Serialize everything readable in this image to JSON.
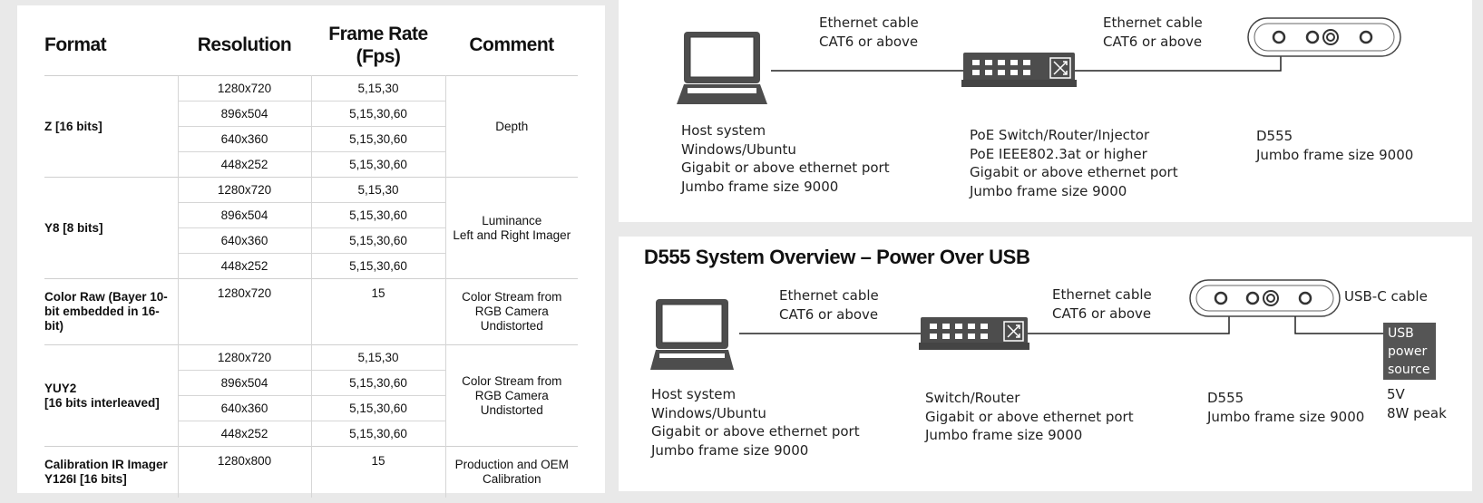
{
  "table": {
    "headers": {
      "format": "Format",
      "resolution": "Resolution",
      "frame_rate_1": "Frame Rate",
      "frame_rate_2": "(Fps)",
      "comment": "Comment"
    },
    "groups": [
      {
        "format": "Z [16 bits]",
        "comment": [
          "Depth"
        ],
        "rows": [
          {
            "res": "1280x720",
            "fps": "5,15,30"
          },
          {
            "res": "896x504",
            "fps": "5,15,30,60"
          },
          {
            "res": "640x360",
            "fps": "5,15,30,60"
          },
          {
            "res": "448x252",
            "fps": "5,15,30,60"
          }
        ]
      },
      {
        "format": "Y8 [8 bits]",
        "comment": [
          "Luminance",
          "Left and Right Imager"
        ],
        "rows": [
          {
            "res": "1280x720",
            "fps": "5,15,30"
          },
          {
            "res": "896x504",
            "fps": "5,15,30,60"
          },
          {
            "res": "640x360",
            "fps": "5,15,30,60"
          },
          {
            "res": "448x252",
            "fps": "5,15,30,60"
          }
        ]
      },
      {
        "format": "Color Raw (Bayer 10-bit embedded in 16-bit)",
        "comment": [
          "Color Stream from",
          "RGB Camera",
          "Undistorted"
        ],
        "rows": [
          {
            "res": "1280x720",
            "fps": "15"
          }
        ]
      },
      {
        "format": "YUY2\n[16 bits interleaved]",
        "comment": [
          "Color Stream from",
          "RGB Camera",
          "Undistorted"
        ],
        "rows": [
          {
            "res": "1280x720",
            "fps": "5,15,30"
          },
          {
            "res": "896x504",
            "fps": "5,15,30,60"
          },
          {
            "res": "640x360",
            "fps": "5,15,30,60"
          },
          {
            "res": "448x252",
            "fps": "5,15,30,60"
          }
        ]
      },
      {
        "format": "Calibration IR Imager Y126I [16 bits]",
        "comment": [
          "Production and OEM",
          "Calibration"
        ],
        "rows": [
          {
            "res": "1280x800",
            "fps": "15"
          }
        ]
      }
    ]
  },
  "poe": {
    "cable1": [
      "Ethernet cable",
      "CAT6 or above"
    ],
    "cable2": [
      "Ethernet cable",
      "CAT6 or above"
    ],
    "host": [
      "Host system",
      "Windows/Ubuntu",
      "Gigabit or above ethernet port",
      "Jumbo frame size 9000"
    ],
    "switch": [
      "PoE Switch/Router/Injector",
      "PoE IEEE802.3at or higher",
      "Gigabit or above ethernet port",
      "Jumbo frame size 9000"
    ],
    "camera": [
      "D555",
      "Jumbo frame size 9000"
    ]
  },
  "usb": {
    "title": "D555 System Overview – Power Over USB",
    "cable1": [
      "Ethernet cable",
      "CAT6 or above"
    ],
    "cable2": [
      "Ethernet cable",
      "CAT6 or above"
    ],
    "usb_cable": "USB-C cable",
    "power_box": [
      "USB",
      "power",
      "source"
    ],
    "host": [
      "Host system",
      "Windows/Ubuntu",
      "Gigabit or above ethernet port",
      "Jumbo frame size 9000"
    ],
    "switch": [
      "Switch/Router",
      "Gigabit or above ethernet port",
      "Jumbo frame size 9000"
    ],
    "camera": [
      "D555",
      "Jumbo frame size 9000"
    ],
    "power": [
      "5V",
      "8W peak"
    ]
  },
  "icons": [
    "laptop-icon",
    "network-switch-icon",
    "depth-camera-icon",
    "shuffle-icon"
  ]
}
